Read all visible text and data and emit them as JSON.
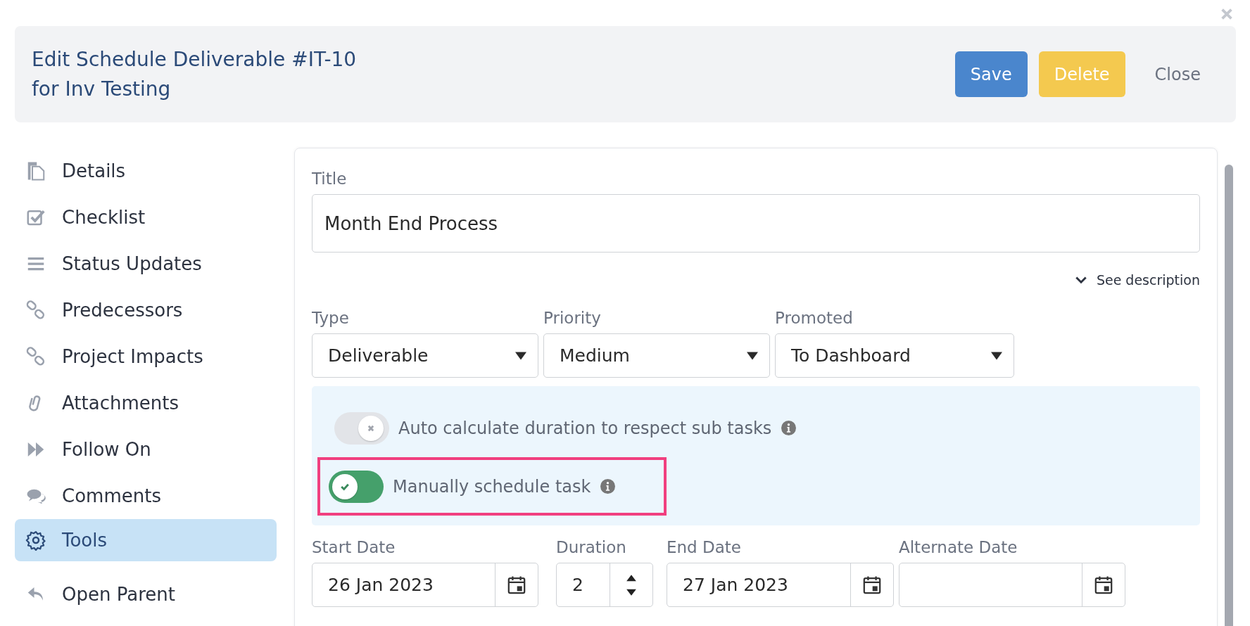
{
  "header": {
    "title_lines": [
      "Edit Schedule Deliverable #IT-10",
      "for Inv Testing"
    ],
    "buttons": [
      {
        "label": "Save",
        "kind": "primary"
      },
      {
        "label": "Delete",
        "kind": "warning"
      },
      {
        "label": "Close",
        "kind": "link"
      }
    ]
  },
  "sidebar": {
    "items": [
      {
        "label": "Details",
        "selected": false
      },
      {
        "label": "Checklist",
        "selected": false
      },
      {
        "label": "Status Updates",
        "selected": false
      },
      {
        "label": "Predecessors",
        "selected": false
      },
      {
        "label": "Project Impacts",
        "selected": false
      },
      {
        "label": "Attachments",
        "selected": false
      },
      {
        "label": "Follow On",
        "selected": false
      },
      {
        "label": "Comments",
        "selected": false
      },
      {
        "label": "Tools",
        "selected": true
      },
      {
        "label": "Open Parent",
        "selected": false
      }
    ]
  },
  "form": {
    "title_label": "Title",
    "title_value": "Month End Process",
    "description_toggle": "See description",
    "selects": [
      {
        "label": "Type",
        "value": "Deliverable"
      },
      {
        "label": "Priority",
        "value": "Medium"
      },
      {
        "label": "Promoted",
        "value": "To Dashboard"
      }
    ],
    "switches": [
      {
        "label": "Auto calculate duration to respect sub tasks",
        "on": false,
        "highlighted": false
      },
      {
        "label": "Manually schedule task",
        "on": true,
        "highlighted": true
      }
    ],
    "dates": [
      {
        "label": "Start Date",
        "kind": "date",
        "value": "26 Jan 2023"
      },
      {
        "label": "Duration",
        "kind": "number",
        "value": "2"
      },
      {
        "label": "End Date",
        "kind": "date",
        "value": "27 Jan 2023"
      },
      {
        "label": "Alternate Date",
        "kind": "date"
      }
    ]
  }
}
